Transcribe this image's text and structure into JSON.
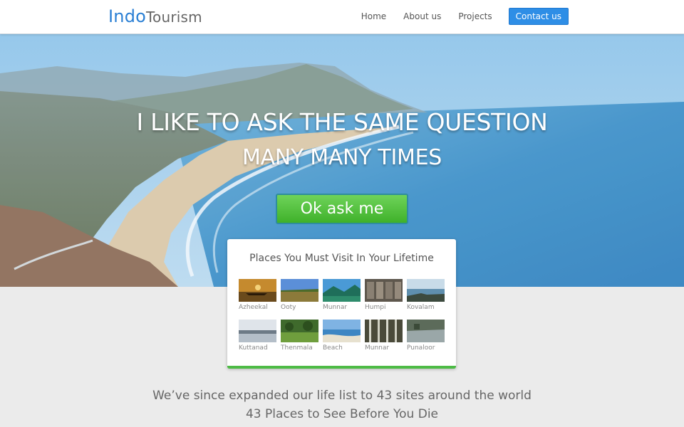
{
  "header": {
    "logo_part1": "Indo",
    "logo_part2": "Tourism",
    "nav": [
      "Home",
      "About us",
      "Projects"
    ],
    "cta": "Contact us"
  },
  "hero": {
    "title_line1": "I LIKE TO ASK THE SAME QUESTION",
    "title_line2": "MANY MANY TIMES",
    "button": "Ok ask me"
  },
  "places": {
    "title": "Places You Must Visit In Your Lifetime",
    "items": [
      {
        "name": "Azheekal"
      },
      {
        "name": "Ooty"
      },
      {
        "name": "Munnar"
      },
      {
        "name": "Humpi"
      },
      {
        "name": "Kovalam"
      },
      {
        "name": "Kuttanad"
      },
      {
        "name": "Thenmala"
      },
      {
        "name": "Beach"
      },
      {
        "name": "Munnar"
      },
      {
        "name": "Punaloor"
      }
    ]
  },
  "footer_text": {
    "line1": "We’ve since expanded our life list to 43 sites around the world",
    "line2": "43 Places to See Before You Die"
  },
  "colors": {
    "brand_blue": "#2a7fd4",
    "cta_green": "#4dbb45",
    "contact_blue": "#2e8ee6"
  }
}
